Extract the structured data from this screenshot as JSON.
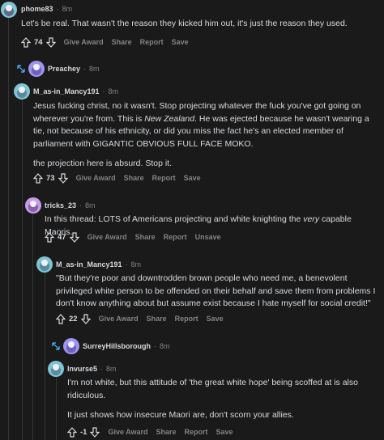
{
  "comments": [
    {
      "username": "phome83",
      "time": "8m",
      "paragraphs": [
        "Let's be real. That wasn't the reason they kicked him out, it's just the reason they used."
      ],
      "votes": "74",
      "actions": [
        "Give Award",
        "Share",
        "Report",
        "Save"
      ]
    },
    {
      "username": "Preachey",
      "time": "8m"
    },
    {
      "username": "M_as-in_Mancy191",
      "time": "8m",
      "p1_a": "Jesus fucking christ, no it wasn't. Stop projecting whatever the fuck you've got going on wherever you're from. This is ",
      "p1_em": "New Zealand",
      "p1_b": ". He was ejected because he wasn't wearing a tie, not because of his ethnicity, or did you miss the fact he's an elected member of parliament with GIGANTIC OBVIOUS FULL FACE MOKO.",
      "p2": "the projection here is absurd. Stop it.",
      "votes": "73",
      "actions": [
        "Give Award",
        "Share",
        "Report",
        "Save"
      ]
    },
    {
      "username": "tricks_23",
      "time": "8m",
      "p1_a": "In this thread: LOTS of Americans projecting and white knighting the ",
      "p1_em": "very",
      "p1_b": " capable Maoris.",
      "votes": "47",
      "actions": [
        "Give Award",
        "Share",
        "Report",
        "Unsave"
      ]
    },
    {
      "username": "M_as-in_Mancy191",
      "time": "8m",
      "p1": "\"But they're poor and downtrodden brown people who need me, a benevolent privileged white person to be offended on their behalf and save them from problems I don't know anything about but assume exist because I hate myself for social credit!\"",
      "votes": "22",
      "actions": [
        "Give Award",
        "Share",
        "Report",
        "Save"
      ]
    },
    {
      "username": "SurreyHillsborough",
      "time": "8m"
    },
    {
      "username": "Invurse5",
      "time": "8m",
      "p1": "I'm not white, but this attitude of 'the great white hope' being scoffed at is also ridiculous.",
      "p2": "It just shows how insecure Maori are, don't scorn your allies.",
      "votes": "-1",
      "actions": [
        "Give Award",
        "Share",
        "Report",
        "Save"
      ]
    }
  ],
  "separator": "·",
  "icons": {
    "upvote": "upvote-arrow-icon",
    "downvote": "downvote-arrow-icon",
    "expand": "expand-arrows-icon",
    "avatar": "snoo-avatar-icon"
  },
  "colors": {
    "bg": "#1a1a1b",
    "text": "#d7dadc",
    "muted": "#818384",
    "avatar_purple": "#a193f0",
    "avatar_teal": "#7fc4d0"
  }
}
